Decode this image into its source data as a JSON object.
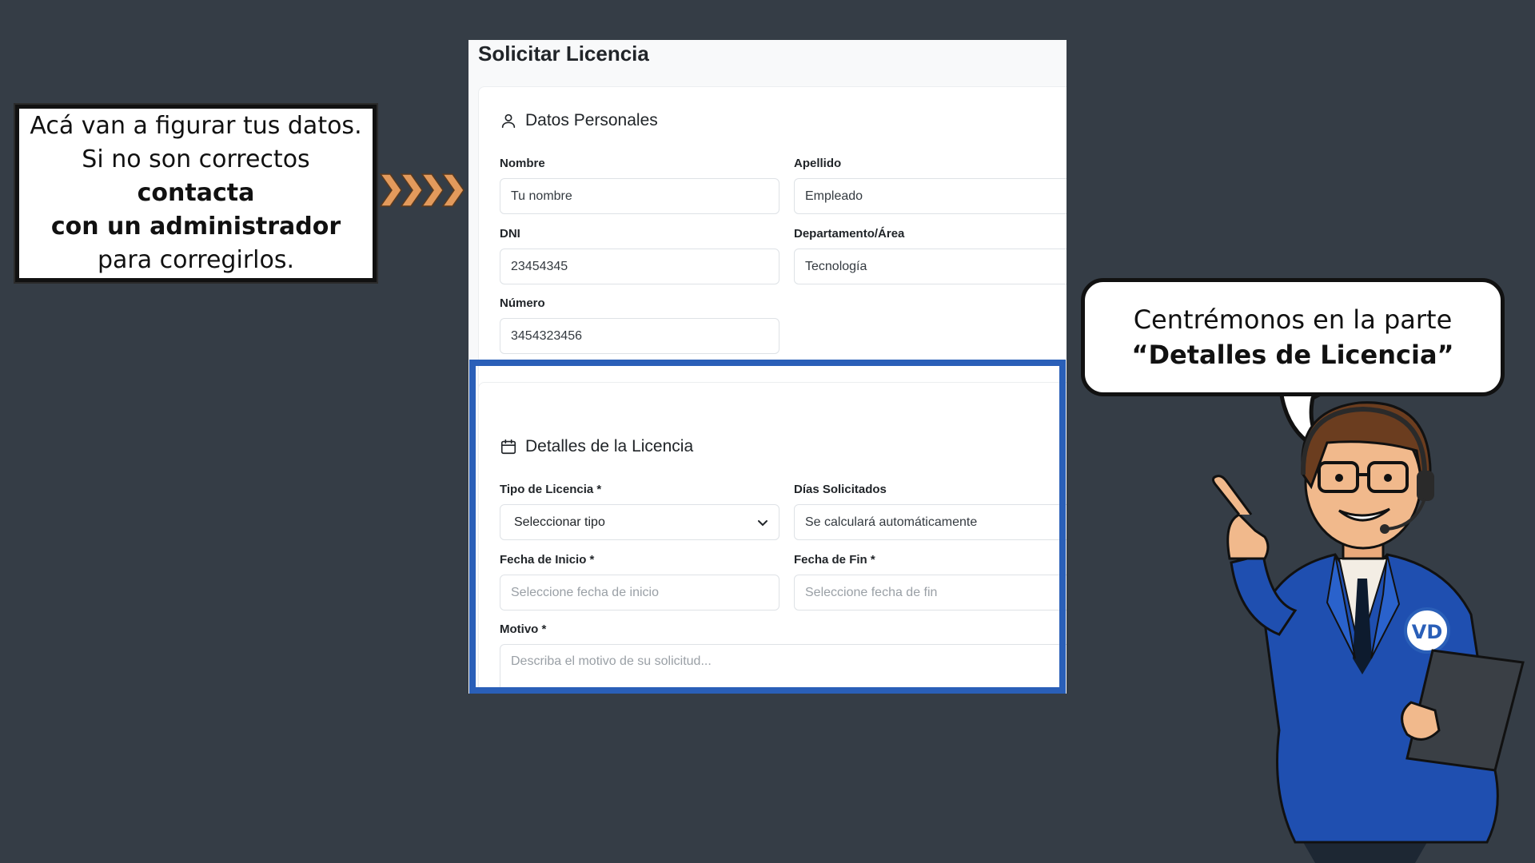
{
  "annotation": {
    "line1": "Acá van a figurar tus datos.",
    "line2_prefix": "Si no son correctos ",
    "line2_bold": "contacta",
    "line3_bold": "con un administrador",
    "line4": "para corregirlos."
  },
  "app": {
    "title": "Solicitar Licencia",
    "personal": {
      "header": "Datos Personales",
      "icon": "user-icon",
      "fields": {
        "nombre": {
          "label": "Nombre",
          "value": "Tu nombre"
        },
        "apellido": {
          "label": "Apellido",
          "value": "Empleado"
        },
        "dni": {
          "label": "DNI",
          "value": "23454345"
        },
        "departamento": {
          "label": "Departamento/Área",
          "value": "Tecnología"
        },
        "numero": {
          "label": "Número",
          "value": "3454323456"
        }
      }
    },
    "details": {
      "header": "Detalles de la Licencia",
      "icon": "calendar-icon",
      "fields": {
        "tipo": {
          "label": "Tipo de Licencia *",
          "value": "Seleccionar tipo"
        },
        "dias": {
          "label": "Días Solicitados",
          "value": "Se calculará automáticamente"
        },
        "inicio": {
          "label": "Fecha de Inicio *",
          "placeholder": "Seleccione fecha de inicio"
        },
        "fin": {
          "label": "Fecha de Fin *",
          "placeholder": "Seleccione fecha de fin"
        },
        "motivo": {
          "label": "Motivo *",
          "placeholder": "Describa el motivo de su solicitud..."
        }
      }
    }
  },
  "bubble": {
    "line1": "Centrémonos en la parte",
    "line2": "“Detalles de Licencia”"
  },
  "character": {
    "badge": "VD"
  },
  "colors": {
    "background": "#353d46",
    "highlight": "#2a5fb8",
    "chevrons": "#e39a5c",
    "jacket": "#1f4fb0"
  }
}
